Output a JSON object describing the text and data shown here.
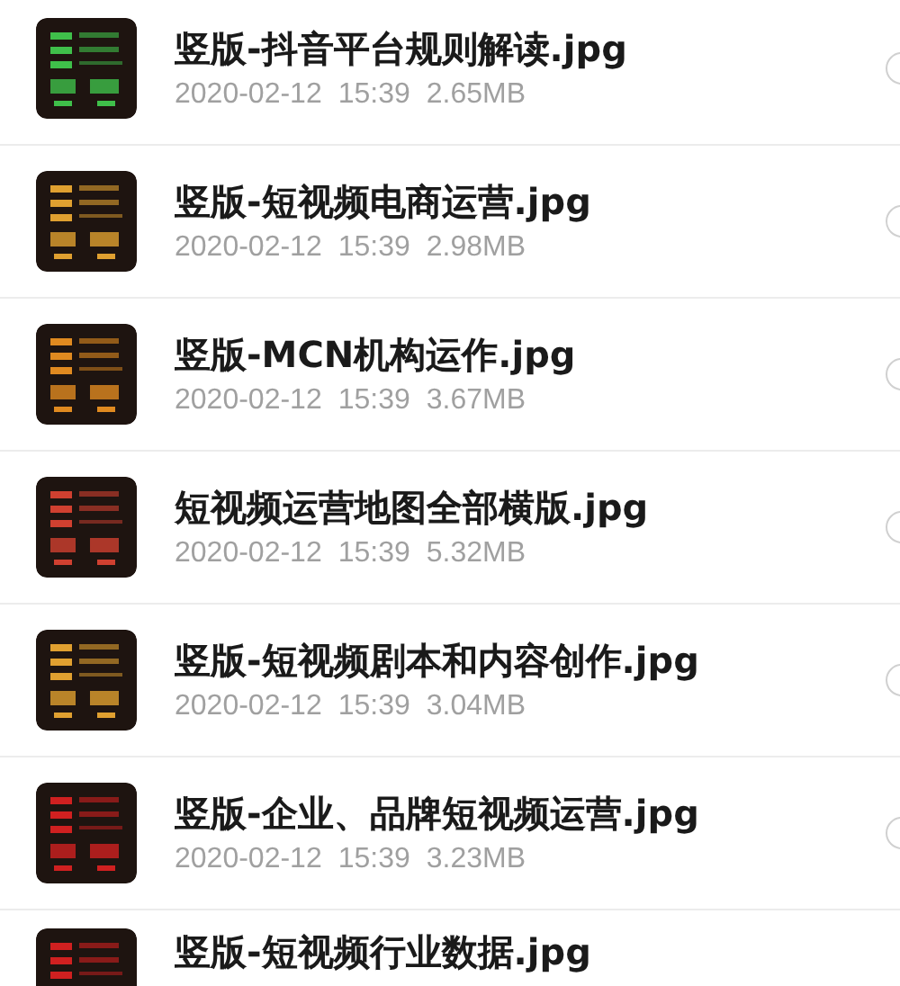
{
  "files": [
    {
      "name": "竖版-抖音平台规则解读.jpg",
      "date": "2020-02-12",
      "time": "15:39",
      "size": "2.65MB",
      "kind": "picture",
      "selected": false
    },
    {
      "name": "竖版-短视频电商运营.jpg",
      "date": "2020-02-12",
      "time": "15:39",
      "size": "2.98MB",
      "kind": "picture",
      "selected": false
    },
    {
      "name": "竖版-MCN机构运作.jpg",
      "date": "2020-02-12",
      "time": "15:39",
      "size": "3.67MB",
      "kind": "picture",
      "selected": false
    },
    {
      "name": "短视频运营地图全部横版.jpg",
      "date": "2020-02-12",
      "time": "15:39",
      "size": "5.32MB",
      "kind": "picture",
      "selected": false
    },
    {
      "name": "竖版-短视频剧本和内容创作.jpg",
      "date": "2020-02-12",
      "time": "15:39",
      "size": "3.04MB",
      "kind": "picture",
      "selected": false
    },
    {
      "name": "竖版-企业、品牌短视频运营.jpg",
      "date": "2020-02-12",
      "time": "15:39",
      "size": "3.23MB",
      "kind": "picture",
      "selected": false
    },
    {
      "name": "竖版-短视频行业数据.jpg",
      "kind": "picture"
    }
  ]
}
